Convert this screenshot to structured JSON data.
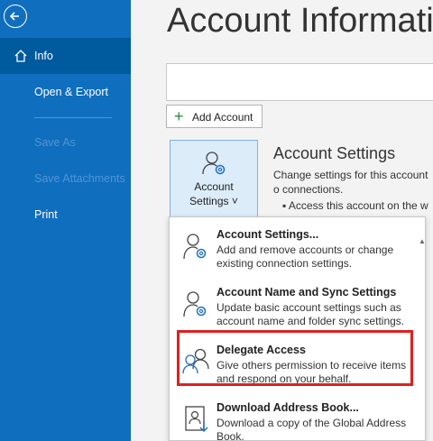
{
  "sidebar": {
    "items": [
      {
        "label": "Info"
      },
      {
        "label": "Open & Export"
      },
      {
        "label": "Save As"
      },
      {
        "label": "Save Attachments"
      },
      {
        "label": "Print"
      }
    ]
  },
  "main": {
    "title": "Account Informati",
    "add_account": "Add Account",
    "settings_button": {
      "line1": "Account",
      "line2": "Settings ˅"
    },
    "section_title": "Account Settings",
    "section_desc": "Change settings for this account o connections.",
    "bullet": "▪  Access this account on the w"
  },
  "menu": {
    "items": [
      {
        "title": "Account Settings...",
        "desc": "Add and remove accounts or change existing connection settings."
      },
      {
        "title": "Account Name and Sync Settings",
        "desc": "Update basic account settings such as account name and folder sync settings."
      },
      {
        "title": "Delegate Access",
        "desc": "Give others permission to receive items and respond on your behalf."
      },
      {
        "title": "Download Address Book...",
        "desc": "Download a copy of the Global Address Book."
      }
    ]
  },
  "colors": {
    "sidebar": "#106ebe",
    "active": "#005a9e",
    "highlight": "#e02020"
  }
}
